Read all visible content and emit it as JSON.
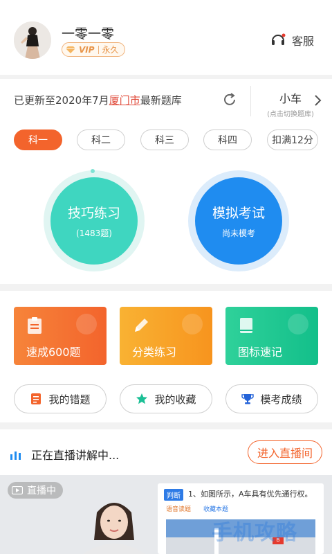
{
  "header": {
    "username": "一零一零",
    "vip_label": "VIP",
    "vip_duration": "永久",
    "service_label": "客服"
  },
  "library": {
    "update_prefix": "已更新至2020年7月",
    "city": "厦门市",
    "update_suffix": "最新题库",
    "vehicle": "小车",
    "vehicle_hint": "(点击切换题库)"
  },
  "tabs": [
    {
      "label": "科一",
      "active": true
    },
    {
      "label": "科二",
      "active": false
    },
    {
      "label": "科三",
      "active": false
    },
    {
      "label": "科四",
      "active": false
    },
    {
      "label": "扣满12分",
      "active": false
    }
  ],
  "circles": {
    "practice": {
      "title": "技巧练习",
      "subtitle": "(1483题)"
    },
    "exam": {
      "title": "模拟考试",
      "subtitle": "尚未模考"
    }
  },
  "features": [
    {
      "label": "速成600题",
      "icon": "clipboard-icon",
      "color": "#f3642c"
    },
    {
      "label": "分类练习",
      "icon": "pencil-icon",
      "color": "#f7941e"
    },
    {
      "label": "图标速记",
      "icon": "book-icon",
      "color": "#13bf8a"
    }
  ],
  "pills": [
    {
      "label": "我的错题",
      "icon": "notebook-icon"
    },
    {
      "label": "我的收藏",
      "icon": "star-icon"
    },
    {
      "label": "模考成绩",
      "icon": "trophy-icon"
    }
  ],
  "live": {
    "status_text": "正在直播讲解中...",
    "enter_label": "进入直播间",
    "tag": "直播中",
    "question_type": "判断",
    "question_text": "1、如图所示，A车具有优先通行权。",
    "read_label": "语音读题",
    "fav_label": "收藏本题",
    "watermark": "手机攻略"
  },
  "colors": {
    "accent": "#f3642c",
    "practice": "#3fd6c0",
    "exam": "#1f8cf0"
  }
}
